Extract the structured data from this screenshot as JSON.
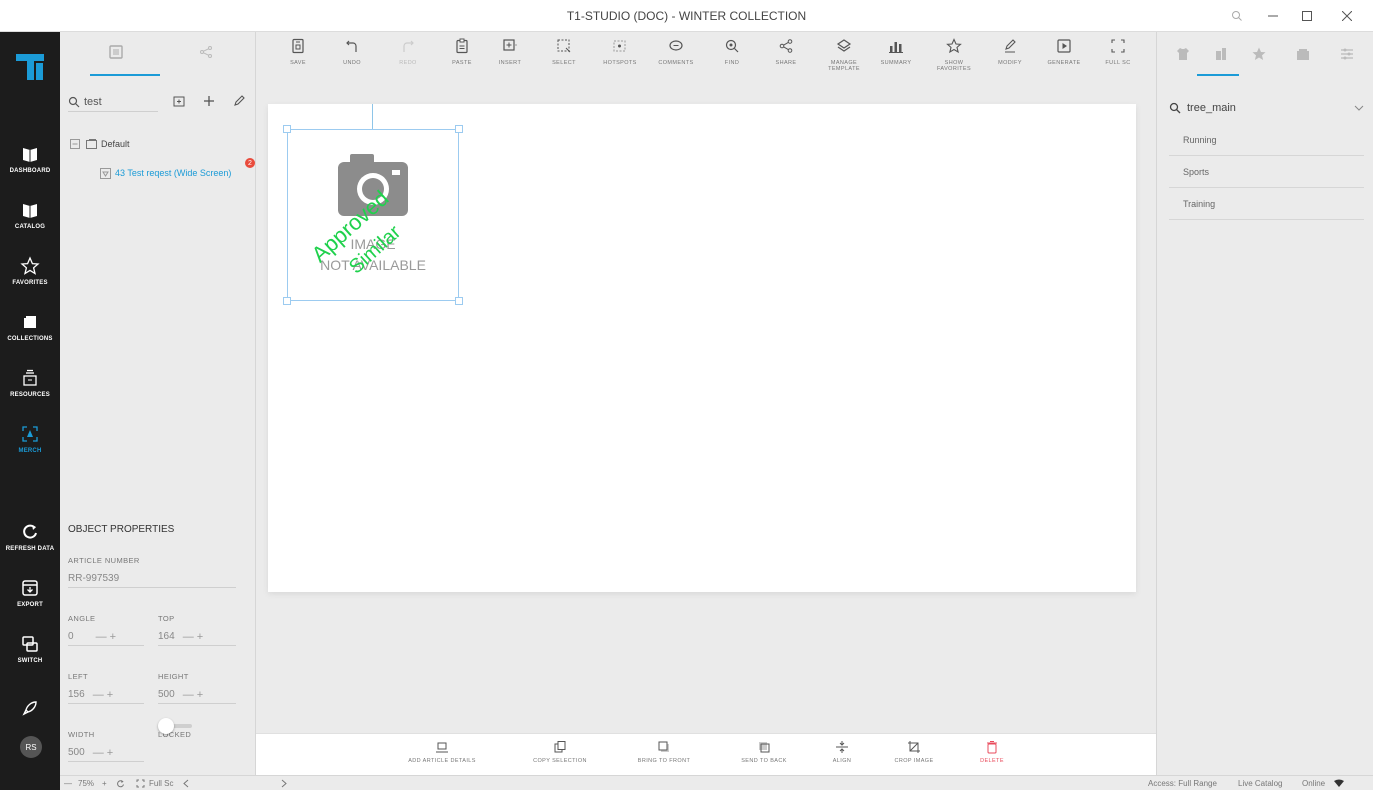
{
  "window": {
    "title": "T1-STUDIO (DOC) - WINTER COLLECTION"
  },
  "nav": {
    "items": [
      {
        "label": "DASHBOARD",
        "icon": "dashboard-icon"
      },
      {
        "label": "CATALOG",
        "icon": "catalog-icon"
      },
      {
        "label": "FAVORITES",
        "icon": "star-icon"
      },
      {
        "label": "COLLECTIONS",
        "icon": "collections-icon"
      },
      {
        "label": "RESOURCES",
        "icon": "resources-icon"
      },
      {
        "label": "MERCH",
        "icon": "merch-icon"
      },
      {
        "label": "REFRESH DATA",
        "icon": "refresh-icon"
      },
      {
        "label": "EXPORT",
        "icon": "export-icon"
      },
      {
        "label": "SWITCH",
        "icon": "switch-icon"
      }
    ],
    "avatar": "RS",
    "accent": "#1b9bd7"
  },
  "left_panel": {
    "search_value": "test",
    "tree": {
      "root": "Default",
      "child": "43  Test reqest (Wide Screen)",
      "badge": "2"
    }
  },
  "properties": {
    "title": "OBJECT PROPERTIES",
    "article_number_label": "ARTICLE NUMBER",
    "article_number": "RR-997539",
    "angle_label": "ANGLE",
    "angle": "0",
    "top_label": "TOP",
    "top": "164",
    "left_label": "LEFT",
    "left": "156",
    "height_label": "HEIGHT",
    "height": "500",
    "width_label": "WIDTH",
    "width": "500",
    "locked_label": "LOCKED",
    "plus_minus": "— +"
  },
  "toolbar": {
    "items": [
      {
        "label": "SAVE"
      },
      {
        "label": "UNDO"
      },
      {
        "label": "REDO"
      },
      {
        "label": "PASTE"
      },
      {
        "label": "INSERT"
      },
      {
        "label": "SELECT"
      },
      {
        "label": "HOTSPOTS"
      },
      {
        "label": "COMMENTS"
      },
      {
        "label": "FIND"
      },
      {
        "label": "SHARE"
      },
      {
        "label": "MANAGE TEMPLATE"
      },
      {
        "label": "SUMMARY"
      },
      {
        "label": "SHOW FAVORITES"
      },
      {
        "label": "MODIFY"
      },
      {
        "label": "GENERATE"
      },
      {
        "label": "FULL SC"
      }
    ]
  },
  "canvas": {
    "image_text_1": "IMAGE",
    "image_text_2": "NOT AVAILABLE",
    "watermark_1": "Approved",
    "watermark_2": "Similar",
    "watermark_color": "#1fd14c"
  },
  "right_panel": {
    "search_value": "tree_main",
    "items": [
      "Running",
      "Sports",
      "Training"
    ]
  },
  "action_bar": {
    "items": [
      {
        "label": "ADD ARTICLE DETAILS"
      },
      {
        "label": "COPY SELECTION"
      },
      {
        "label": "BRING TO FRONT"
      },
      {
        "label": "SEND TO BACK"
      },
      {
        "label": "ALIGN"
      },
      {
        "label": "CROP IMAGE"
      },
      {
        "label": "DELETE"
      }
    ]
  },
  "status": {
    "zoom": "75%",
    "zoom_controls": "— ",
    "zoom_plus": "+",
    "full_screen": "Full Sc",
    "access": "Access: Full Range",
    "catalog": "Live Catalog",
    "online": "Online"
  }
}
